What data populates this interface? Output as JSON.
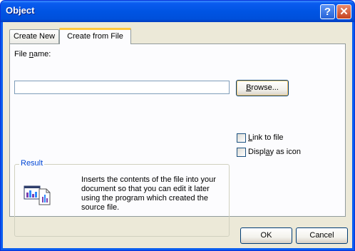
{
  "window": {
    "title": "Object"
  },
  "titlebar": {
    "help_glyph": "?",
    "close_glyph": "✕"
  },
  "tabs": [
    {
      "label": "Create New",
      "active": false
    },
    {
      "label": "Create from File",
      "active": true
    }
  ],
  "file": {
    "label_prefix": "File ",
    "label_hotkey": "n",
    "label_suffix": "ame:",
    "value": ""
  },
  "browse_button": {
    "hotkey": "B",
    "rest": "rowse..."
  },
  "options": {
    "link": {
      "hotkey": "L",
      "rest": "ink to file",
      "checked": false
    },
    "icon": {
      "prefix": "Displ",
      "hotkey": "a",
      "rest": "y as icon",
      "checked": false
    }
  },
  "result": {
    "legend": "Result",
    "description": "Inserts the contents of the file into your document so that you can edit it later using the program which created the source file."
  },
  "buttons": {
    "ok": "OK",
    "cancel": "Cancel"
  },
  "colors": {
    "titlebar": "#0054E3",
    "client": "#ECE9D8",
    "tab_highlight": "#FFC83C",
    "result_legend": "#0046D5"
  }
}
